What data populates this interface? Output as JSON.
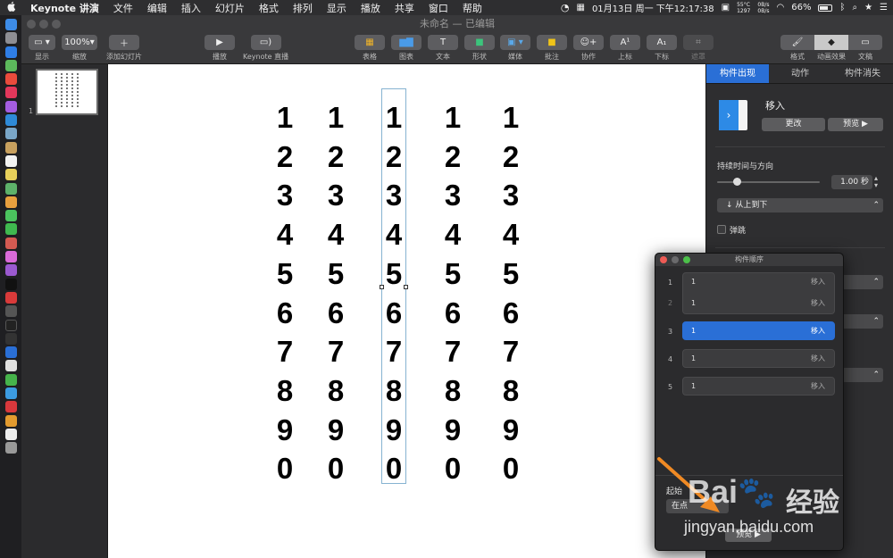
{
  "menubar": {
    "apple": "",
    "app_name": "Keynote 讲演",
    "menus": [
      "文件",
      "编辑",
      "插入",
      "幻灯片",
      "格式",
      "排列",
      "显示",
      "播放",
      "共享",
      "窗口",
      "帮助"
    ],
    "clock": "01月13日 周一 下午12:17:38",
    "temp": "55°C",
    "rpm": "1297",
    "net_up": "0B/s",
    "net_down": "0B/s",
    "battery": "66%"
  },
  "window": {
    "title": "未命名 — 已编辑"
  },
  "toolbar": {
    "view_label": "显示",
    "zoom_value": "100%",
    "zoom_label": "缩放",
    "add_slide_label": "添加幻灯片",
    "play_label": "播放",
    "live_label": "Keynote 直播",
    "table_label": "表格",
    "chart_label": "图表",
    "text_label": "文本",
    "shape_label": "形状",
    "media_label": "媒体",
    "comment_label": "批注",
    "collab_label": "协作",
    "superscript_label": "上标",
    "subscript_label": "下标",
    "mask_label": "遮罩",
    "format_label": "格式",
    "animate_label": "动画效果",
    "document_label": "文稿"
  },
  "navigator": {
    "slide_number": "1"
  },
  "slide": {
    "columns": [
      [
        "1",
        "2",
        "3",
        "4",
        "5",
        "6",
        "7",
        "8",
        "9",
        "0"
      ],
      [
        "1",
        "2",
        "3",
        "4",
        "5",
        "6",
        "7",
        "8",
        "9",
        "0"
      ],
      [
        "1",
        "2",
        "3",
        "4",
        "5",
        "6",
        "7",
        "8",
        "9",
        "0"
      ],
      [
        "1",
        "2",
        "3",
        "4",
        "5",
        "6",
        "7",
        "8",
        "9",
        "0"
      ],
      [
        "1",
        "2",
        "3",
        "4",
        "5",
        "6",
        "7",
        "8",
        "9",
        "0"
      ]
    ],
    "selected_column": 3
  },
  "inspector": {
    "tabs": [
      "构件出现",
      "动作",
      "构件消失"
    ],
    "active_tab": "构件出现",
    "effect_name": "移入",
    "change_button": "更改",
    "preview_button": "预览",
    "duration_section": "持续时间与方向",
    "duration_value": "1.00 秒",
    "direction_value": "从上到下",
    "bounce_label": "弹跳"
  },
  "build_order": {
    "title": "构件顺序",
    "items": [
      {
        "num": "1",
        "text": "1",
        "effect": "移入"
      },
      {
        "num": "2",
        "text": "1",
        "effect": "移入"
      },
      {
        "num": "3",
        "text": "1",
        "effect": "移入"
      },
      {
        "num": "4",
        "text": "1",
        "effect": "移入"
      },
      {
        "num": "5",
        "text": "1",
        "effect": "移入"
      }
    ],
    "start_label": "起始",
    "start_value": "在点",
    "preview_button": "预览"
  },
  "watermark": {
    "site": "jingyan.baidu.com",
    "brand_cn": "经验"
  },
  "colors": {
    "accent": "#2a6fd6",
    "selection": "#86b3d1",
    "arrow": "#f08a24"
  }
}
